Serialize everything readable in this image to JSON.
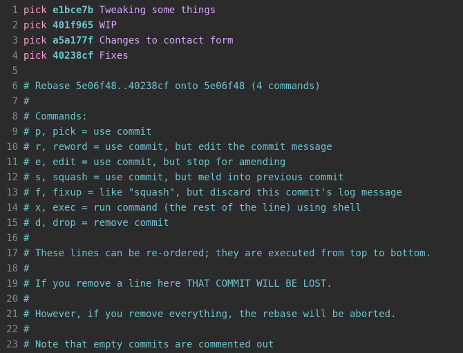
{
  "lines": [
    {
      "n": 1,
      "segments": [
        {
          "cls": "cmd",
          "t": "pick"
        },
        {
          "cls": "plain",
          "t": " "
        },
        {
          "cls": "hash",
          "t": "e1bce7b"
        },
        {
          "cls": "plain",
          "t": " "
        },
        {
          "cls": "msg",
          "t": "Tweaking some things"
        }
      ]
    },
    {
      "n": 2,
      "segments": [
        {
          "cls": "cmd",
          "t": "pick"
        },
        {
          "cls": "plain",
          "t": " "
        },
        {
          "cls": "hash",
          "t": "401f965"
        },
        {
          "cls": "plain",
          "t": " "
        },
        {
          "cls": "msg",
          "t": "WIP"
        }
      ]
    },
    {
      "n": 3,
      "segments": [
        {
          "cls": "cmd",
          "t": "pick"
        },
        {
          "cls": "plain",
          "t": " "
        },
        {
          "cls": "hash",
          "t": "a5a177f"
        },
        {
          "cls": "plain",
          "t": " "
        },
        {
          "cls": "msg",
          "t": "Changes to contact form"
        }
      ]
    },
    {
      "n": 4,
      "segments": [
        {
          "cls": "cmd",
          "t": "pick"
        },
        {
          "cls": "plain",
          "t": " "
        },
        {
          "cls": "hash",
          "t": "40238cf"
        },
        {
          "cls": "plain",
          "t": " "
        },
        {
          "cls": "msg",
          "t": "Fixes"
        }
      ]
    },
    {
      "n": 5,
      "segments": []
    },
    {
      "n": 6,
      "segments": [
        {
          "cls": "comment",
          "t": "# Rebase 5e06f48..40238cf onto 5e06f48 (4 commands)"
        }
      ]
    },
    {
      "n": 7,
      "segments": [
        {
          "cls": "comment",
          "t": "#"
        }
      ]
    },
    {
      "n": 8,
      "segments": [
        {
          "cls": "comment",
          "t": "# Commands:"
        }
      ]
    },
    {
      "n": 9,
      "segments": [
        {
          "cls": "comment",
          "t": "# p, pick = use commit"
        }
      ]
    },
    {
      "n": 10,
      "segments": [
        {
          "cls": "comment",
          "t": "# r, reword = use commit, but edit the commit message"
        }
      ]
    },
    {
      "n": 11,
      "segments": [
        {
          "cls": "comment",
          "t": "# e, edit = use commit, but stop for amending"
        }
      ]
    },
    {
      "n": 12,
      "segments": [
        {
          "cls": "comment",
          "t": "# s, squash = use commit, but meld into previous commit"
        }
      ]
    },
    {
      "n": 13,
      "segments": [
        {
          "cls": "comment",
          "t": "# f, fixup = like \"squash\", but discard this commit's log message"
        }
      ]
    },
    {
      "n": 14,
      "segments": [
        {
          "cls": "comment",
          "t": "# x, exec = run command (the rest of the line) using shell"
        }
      ]
    },
    {
      "n": 15,
      "segments": [
        {
          "cls": "comment",
          "t": "# d, drop = remove commit"
        }
      ]
    },
    {
      "n": 16,
      "segments": [
        {
          "cls": "comment",
          "t": "#"
        }
      ]
    },
    {
      "n": 17,
      "segments": [
        {
          "cls": "comment",
          "t": "# These lines can be re-ordered; they are executed from top to bottom."
        }
      ]
    },
    {
      "n": 18,
      "segments": [
        {
          "cls": "comment",
          "t": "#"
        }
      ]
    },
    {
      "n": 19,
      "segments": [
        {
          "cls": "comment",
          "t": "# If you remove a line here THAT COMMIT WILL BE LOST."
        }
      ]
    },
    {
      "n": 20,
      "segments": [
        {
          "cls": "comment",
          "t": "#"
        }
      ]
    },
    {
      "n": 21,
      "segments": [
        {
          "cls": "comment",
          "t": "# However, if you remove everything, the rebase will be aborted."
        }
      ]
    },
    {
      "n": 22,
      "segments": [
        {
          "cls": "comment",
          "t": "#"
        }
      ]
    },
    {
      "n": 23,
      "segments": [
        {
          "cls": "comment",
          "t": "# Note that empty commits are commented out"
        }
      ]
    }
  ]
}
